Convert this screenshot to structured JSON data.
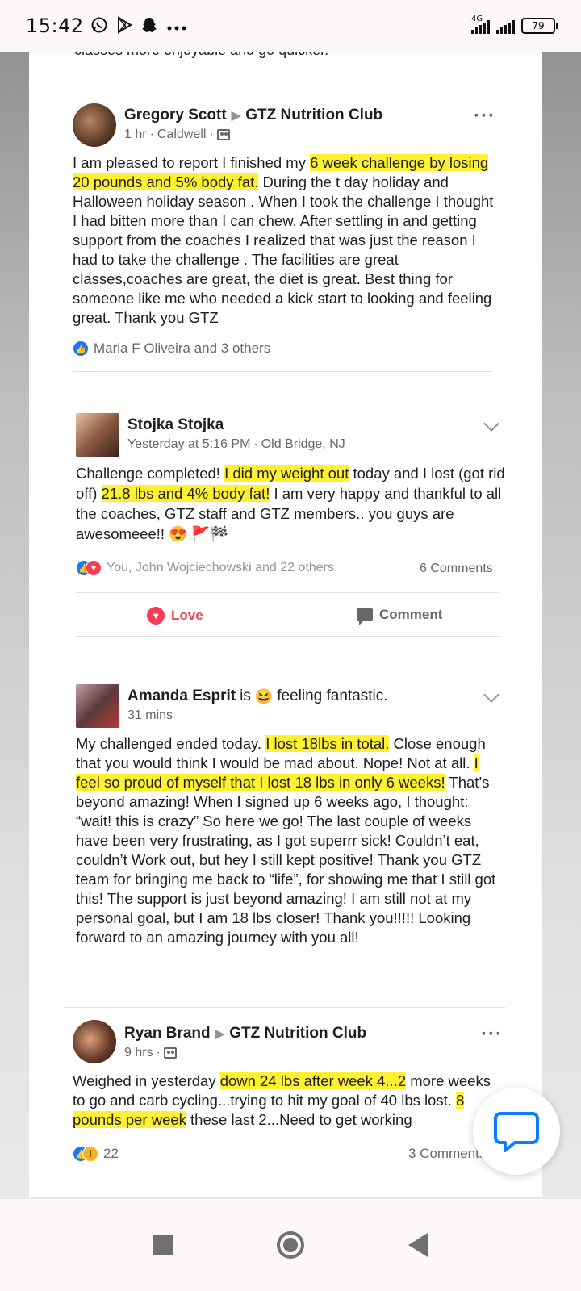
{
  "status_bar": {
    "time": "15:42",
    "left_icons": [
      "whatsapp-icon",
      "play-store-icon",
      "snapchat-icon",
      "more-dots-icon"
    ],
    "network_label": "4G",
    "battery": "79"
  },
  "feed": {
    "cutoff_text": "classes more enjoyable and go quicker.",
    "posts": [
      {
        "author": "Gregory Scott",
        "group": "GTZ Nutrition Club",
        "time": "1 hr",
        "location": "Caldwell",
        "text_segments": [
          {
            "t": "I am pleased to report I finished my ",
            "hl": false
          },
          {
            "t": "6 week challenge by losing 20 pounds and 5% body fat.",
            "hl": true
          },
          {
            "t": " During the t day holiday and Halloween holiday season . When I took the challenge I thought I had bitten more than I can chew. After settling in and getting support from the coaches I realized that was just the reason I had to take the challenge . The facilities are great classes,coaches are great, the diet is great. Best thing for someone like me who needed a kick start to looking and feeling great. Thank you GTZ",
            "hl": false
          }
        ],
        "reactions": "Maria F Oliveira and 3 others"
      },
      {
        "author": "Stojka Stojka",
        "time": "Yesterday at 5:16 PM",
        "location": "Old Bridge, NJ",
        "text_segments": [
          {
            "t": "Challenge completed! ",
            "hl": false
          },
          {
            "t": "I did my weight out",
            "hl": true
          },
          {
            "t": " today and I lost (got rid off) ",
            "hl": false
          },
          {
            "t": "21.8 lbs and 4% body fat!",
            "hl": true
          },
          {
            "t": " I am very happy and thankful to all the coaches, GTZ staff and GTZ members.. you guys are awesomeee!! 😍 🚩🏁",
            "hl": false
          }
        ],
        "reactions": "You, John Wojciechowski and 22 others",
        "comments": "6 Comments",
        "actions": {
          "love": "Love",
          "comment": "Comment"
        }
      },
      {
        "author": "Amanda Esprit",
        "activity_prefix": "is",
        "activity": "feeling fantastic.",
        "activity_emoji": "😆",
        "time": "31 mins",
        "text_segments": [
          {
            "t": "My challenged ended today. ",
            "hl": false
          },
          {
            "t": "I lost 18lbs in total.",
            "hl": true
          },
          {
            "t": " Close enough that you would think I would be mad about. Nope! Not at all. ",
            "hl": false
          },
          {
            "t": "I feel so proud of myself that I lost 18 lbs in only 6 weeks!",
            "hl": true
          },
          {
            "t": " That’s beyond amazing! When I signed up 6 weeks ago, I thought: “wait! this is crazy” So here we go! The last couple of weeks have been very frustrating, as I got superrr sick! Couldn’t eat, couldn’t Work out, but hey I still kept positive! Thank you GTZ team for bringing me back to “life”, for showing me that I still got this! The support is just beyond amazing! I am still not at my personal goal, but I am 18 lbs closer! Thank you!!!!! Looking forward to an amazing journey with you all!",
            "hl": false
          }
        ]
      },
      {
        "author": "Ryan Brand",
        "group": "GTZ Nutrition Club",
        "time": "9 hrs",
        "text_segments": [
          {
            "t": "Weighed in yesterday ",
            "hl": false
          },
          {
            "t": "down 24 lbs after week 4...2",
            "hl": true
          },
          {
            "t": " more weeks to go and carb cycling...trying to hit my goal of 40 lbs lost. ",
            "hl": false
          },
          {
            "t": "8 pounds per week",
            "hl": true
          },
          {
            "t": " these last 2...Need to get working",
            "hl": false
          }
        ],
        "reaction_count": "22",
        "comments": "3 Comments"
      }
    ]
  },
  "colors": {
    "highlight": "#fff130",
    "facebook_blue": "#1877f2",
    "love_red": "#f33e58",
    "chat_blue": "#0a7cff"
  },
  "nav": {
    "icons": [
      "recents-square-icon",
      "home-circle-icon",
      "back-triangle-icon"
    ]
  }
}
